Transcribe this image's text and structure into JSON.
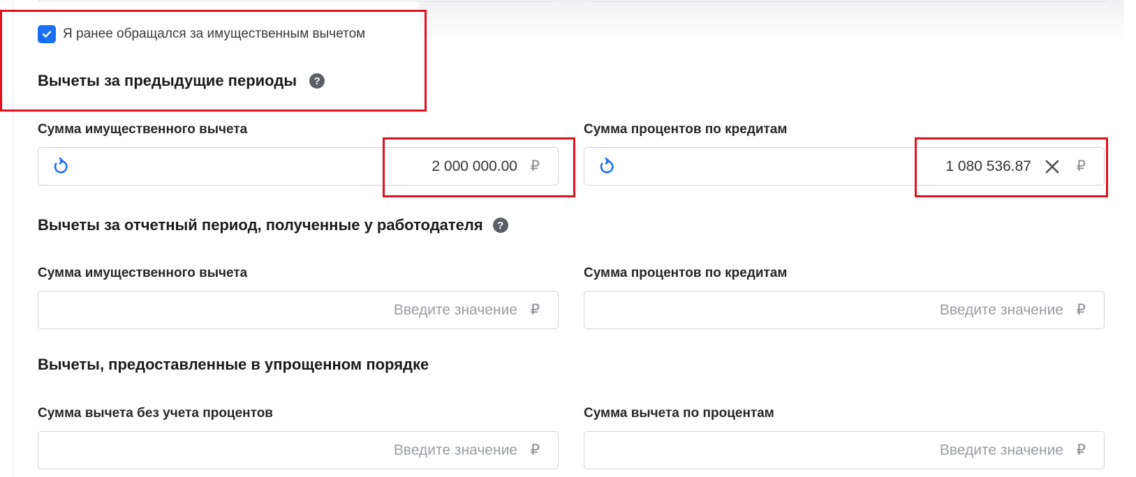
{
  "previous_request": {
    "checked": true,
    "label": "Я ранее обращался за имущественным вычетом"
  },
  "sections": {
    "previous_periods": {
      "title": "Вычеты за предыдущие периоды",
      "help": "?",
      "property_label": "Сумма имущественного вычета",
      "property_value": "2 000 000.00",
      "interest_label": "Сумма процентов по кредитам",
      "interest_value": "1 080 536.87"
    },
    "employer": {
      "title": "Вычеты за отчетный период, полученные у работодателя",
      "help": "?",
      "property_label": "Сумма имущественного вычета",
      "interest_label": "Сумма процентов по кредитам"
    },
    "simplified": {
      "title": "Вычеты, предоставленные в упрощенном порядке",
      "no_interest_label": "Сумма вычета без учета процентов",
      "interest_label": "Сумма вычета по процентам"
    }
  },
  "common": {
    "placeholder": "Введите значение",
    "currency": "₽"
  },
  "colors": {
    "accent": "#1a6ef5",
    "highlight": "#e3111b",
    "placeholder": "#9a9da3"
  }
}
